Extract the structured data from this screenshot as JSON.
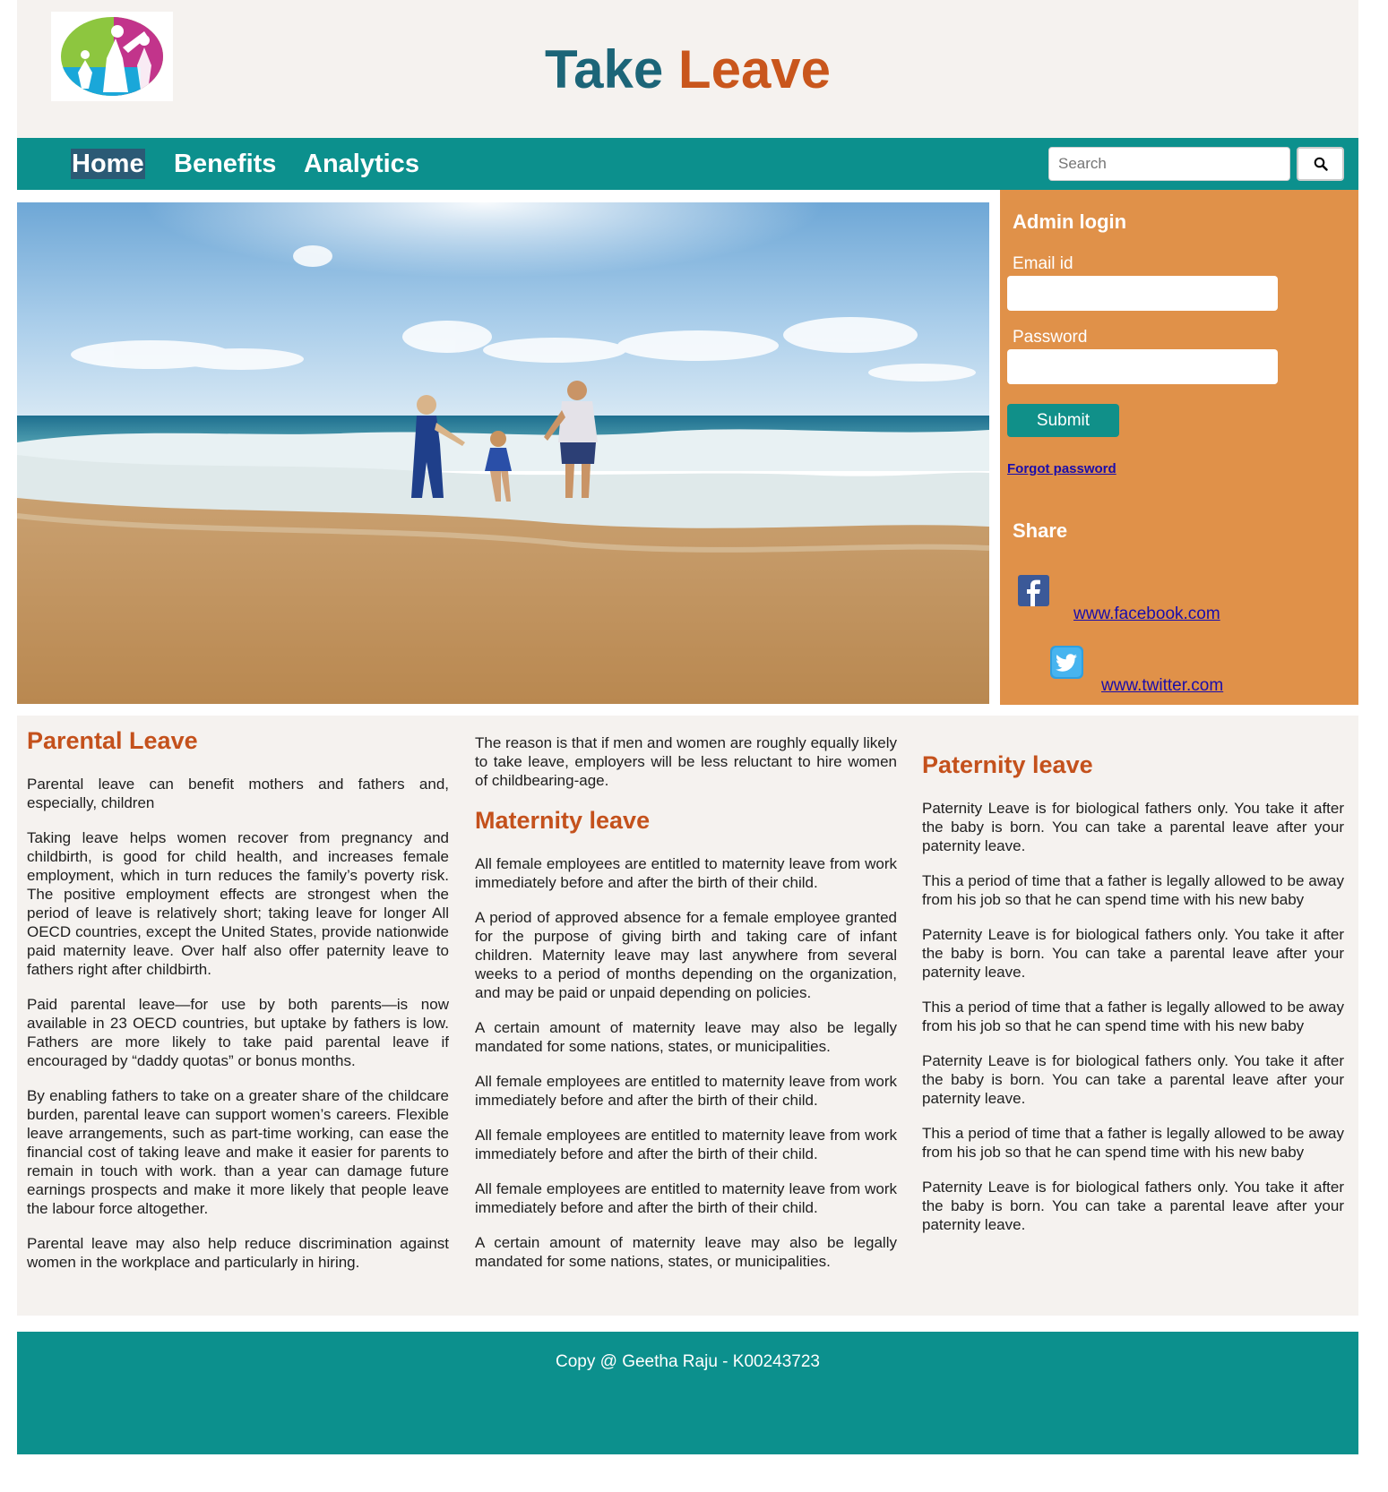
{
  "header": {
    "title_part1": "Take",
    "title_part2": "Leave"
  },
  "nav": {
    "items": [
      {
        "label": "Home",
        "active": true
      },
      {
        "label": "Benefits",
        "active": false
      },
      {
        "label": "Analytics",
        "active": false
      }
    ],
    "search": {
      "placeholder": "Search",
      "button_icon": "search-icon"
    }
  },
  "sidebar": {
    "login_heading": "Admin login",
    "email_label": "Email id",
    "password_label": "Password",
    "submit_label": "Submit",
    "forgot_label": "Forgot password",
    "share_heading": "Share",
    "facebook": {
      "icon": "facebook-icon",
      "label": "www.facebook.com"
    },
    "twitter": {
      "icon": "twitter-icon",
      "label": "www.twitter.com"
    }
  },
  "content": {
    "col1": {
      "heading": "Parental Leave",
      "paragraphs": [
        "Parental leave can benefit mothers and fathers and, especially, children",
        "Taking leave helps women recover from pregnancy and childbirth, is good for child health, and increases female employment, which in turn reduces the family’s poverty risk. The positive employment effects are strongest when the period of leave is relatively short; taking leave for longer All OECD countries, except the United States, provide nationwide paid maternity leave. Over half also offer paternity leave to fathers right after childbirth.",
        "Paid parental leave—for use by both parents—is now available in 23 OECD countries, but uptake by fathers is low. Fathers are more likely to take paid parental leave if encouraged by “daddy quotas” or bonus months.",
        "By enabling fathers to take on a greater share of the childcare burden, parental leave can support women’s careers. Flexible leave arrangements, such as part-time working, can ease the financial cost of taking leave and make it easier for parents to remain in touch with work. than a year can damage future earnings prospects and make it more likely that people leave the labour force altogether.",
        "Parental leave may also help reduce discrimination against women in the workplace and particularly in hiring."
      ]
    },
    "col2": {
      "intro": "The reason is that if men and women are roughly equally likely to take leave, employers will be less reluctant to hire women of childbearing-age.",
      "heading": "Maternity leave",
      "paragraphs": [
        "All female employees are entitled to maternity leave from work immediately before and after the birth of their child.",
        "A period of approved absence for a female employee granted for the purpose of giving birth and taking care of infant children. Maternity leave may last anywhere from several weeks to a period of months depending on the organization, and may be paid or unpaid depending on policies.",
        "A certain amount of maternity leave may also be legally mandated for some nations, states, or municipalities.",
        "All female employees are entitled to maternity leave from work immediately before and after the birth of their child.",
        "All female employees are entitled to maternity leave from work immediately before and after the birth of their child.",
        "All female employees are entitled to maternity leave from work immediately before and after the birth of their child.",
        "A certain amount of maternity leave may also be legally mandated for some nations, states, or municipalities."
      ]
    },
    "col3": {
      "heading": "Paternity leave",
      "paragraphs": [
        "Paternity Leave is for biological fathers only. You take it after the baby is born. You can take a parental leave after your paternity leave.",
        "This a period of time that a father is legally allowed to be away from his job so that he can spend time with his new baby",
        "Paternity Leave is for biological fathers only. You take it after the baby is born. You can take a parental leave after your paternity leave.",
        "This a period of time that a father is legally allowed to be away from his job so that he can spend time with his new baby",
        "Paternity Leave is for biological fathers only. You take it after the baby is born. You can take a parental leave after your paternity leave.",
        "This a period of time that a father is legally allowed to be away from his job so that he can spend time with his new baby",
        "Paternity Leave is for biological fathers only. You take it after the baby is born. You can take a parental leave after your paternity leave."
      ]
    }
  },
  "footer": {
    "text": "Copy @ Geetha Raju - K00243723"
  },
  "colors": {
    "teal": "#0c908d",
    "orange_panel": "#e09149",
    "heading_orange": "#c4511c",
    "title_blue": "#1c6578",
    "cream": "#f5f2ef"
  }
}
